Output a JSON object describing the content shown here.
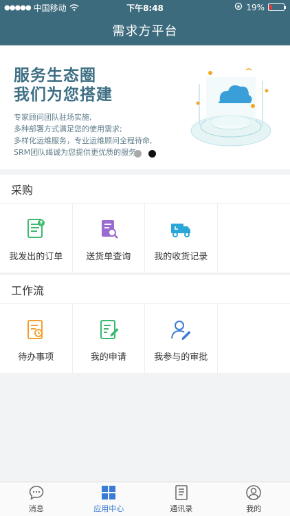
{
  "status": {
    "carrier": "中国移动",
    "time": "下午8:48",
    "battery": "19%",
    "battery_level": 0.19
  },
  "header": {
    "title": "需求方平台"
  },
  "banner": {
    "title_line1": "服务生态圈",
    "title_line2": "我们为您搭建",
    "desc": [
      "专家顾问团队驻场实施,",
      "多种部署方式满足您的使用需求;",
      "多样化运维服务，专业运维顾问全程待命,",
      "SRM团队竭诚为您提供更优质的服务。"
    ]
  },
  "procurement": {
    "title": "采购",
    "items": [
      {
        "label": "我发出的订单",
        "icon": "order-doc-icon",
        "color": "#3cba6e"
      },
      {
        "label": "送货单查询",
        "icon": "delivery-search-icon",
        "color": "#9a6bd0"
      },
      {
        "label": "我的收货记录",
        "icon": "truck-icon",
        "color": "#2aa6d8"
      }
    ]
  },
  "workflow": {
    "title": "工作流",
    "items": [
      {
        "label": "待办事项",
        "icon": "todo-icon",
        "color": "#f0a030"
      },
      {
        "label": "我的申请",
        "icon": "application-edit-icon",
        "color": "#36b870"
      },
      {
        "label": "我参与的审批",
        "icon": "user-edit-icon",
        "color": "#3a7bd5"
      }
    ]
  },
  "tabs": [
    {
      "label": "消息",
      "icon": "chat-icon"
    },
    {
      "label": "应用中心",
      "icon": "grid-icon",
      "active": true
    },
    {
      "label": "通讯录",
      "icon": "contacts-icon"
    },
    {
      "label": "我的",
      "icon": "profile-icon"
    }
  ]
}
